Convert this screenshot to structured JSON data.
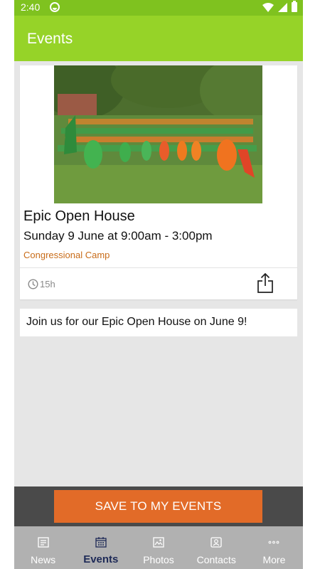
{
  "status_bar": {
    "time": "2:40"
  },
  "app_bar": {
    "title": "Events"
  },
  "event": {
    "title": "Epic Open House",
    "datetime": "Sunday 9 June at 9:00am - 3:00pm",
    "location": "Congressional Camp",
    "time_ago": "15h",
    "description": "Join us for our Epic Open House on June 9!"
  },
  "save_button": {
    "label": "SAVE TO MY EVENTS"
  },
  "bottom_nav": {
    "items": [
      {
        "label": "News",
        "icon": "newspaper-icon"
      },
      {
        "label": "Events",
        "icon": "calendar-icon"
      },
      {
        "label": "Photos",
        "icon": "photo-icon"
      },
      {
        "label": "Contacts",
        "icon": "contact-card-icon"
      },
      {
        "label": "More",
        "icon": "more-dots-icon"
      }
    ],
    "active": "Events"
  },
  "colors": {
    "status_bar": "#7fc21f",
    "app_bar": "#96d328",
    "accent_orange": "#e26b28",
    "location_text": "#c86c19",
    "nav_background": "#b1b1b1",
    "nav_active": "#1e2a57"
  }
}
